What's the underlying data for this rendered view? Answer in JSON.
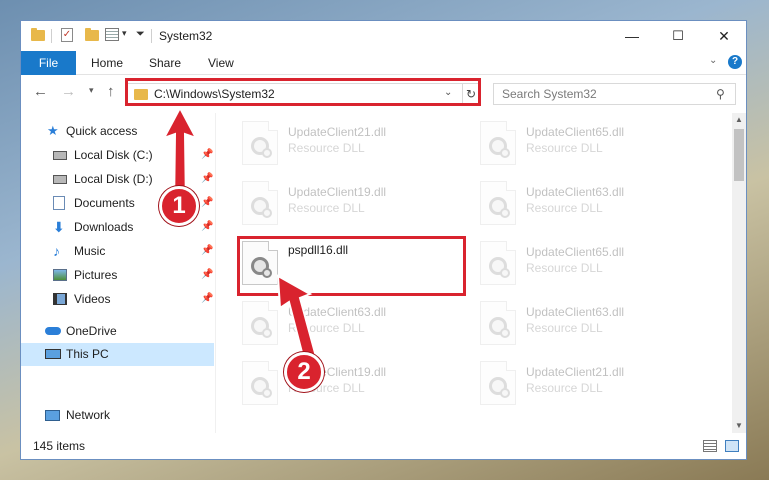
{
  "window": {
    "title": "System32",
    "controls": {
      "minimize": "—",
      "maximize": "☐",
      "close": "✕"
    }
  },
  "ribbon": {
    "file_tab": "File",
    "tabs": [
      "Home",
      "Share",
      "View"
    ],
    "expand_icon": "chevron-down",
    "help_label": "?"
  },
  "navigation": {
    "address": "C:\\Windows\\System32",
    "search_placeholder": "Search System32"
  },
  "sidebar": {
    "quick_access": "Quick access",
    "items": [
      {
        "label": "Local Disk (C:)",
        "icon": "drive-icon",
        "pinned": true
      },
      {
        "label": "Local Disk (D:)",
        "icon": "drive-icon",
        "pinned": true
      },
      {
        "label": "Documents",
        "icon": "documents-icon",
        "pinned": true
      },
      {
        "label": "Downloads",
        "icon": "downloads-icon",
        "pinned": true
      },
      {
        "label": "Music",
        "icon": "music-icon",
        "pinned": true
      },
      {
        "label": "Pictures",
        "icon": "pictures-icon",
        "pinned": true
      },
      {
        "label": "Videos",
        "icon": "videos-icon",
        "pinned": true
      }
    ],
    "onedrive": "OneDrive",
    "this_pc": "This PC",
    "network": "Network"
  },
  "files": {
    "left_column": [
      {
        "name": "UpdateClient21.dll",
        "type": "Resource DLL"
      },
      {
        "name": "UpdateClient19.dll",
        "type": "Resource DLL"
      },
      {
        "name": "pspdll16.dll",
        "type": ""
      },
      {
        "name": "UpdateClient63.dll",
        "type": "Resource DLL"
      },
      {
        "name": "UpdateClient19.dll",
        "type": "Resource DLL"
      }
    ],
    "right_column": [
      {
        "name": "UpdateClient65.dll",
        "type": "Resource DLL"
      },
      {
        "name": "UpdateClient63.dll",
        "type": "Resource DLL"
      },
      {
        "name": "UpdateClient65.dll",
        "type": "Resource DLL"
      },
      {
        "name": "UpdateClient63.dll",
        "type": "Resource DLL"
      },
      {
        "name": "UpdateClient21.dll",
        "type": "Resource DLL"
      }
    ]
  },
  "status": {
    "item_count": "145 items"
  },
  "annotations": {
    "step1": "1",
    "step2": "2",
    "color": "#d9232e"
  }
}
